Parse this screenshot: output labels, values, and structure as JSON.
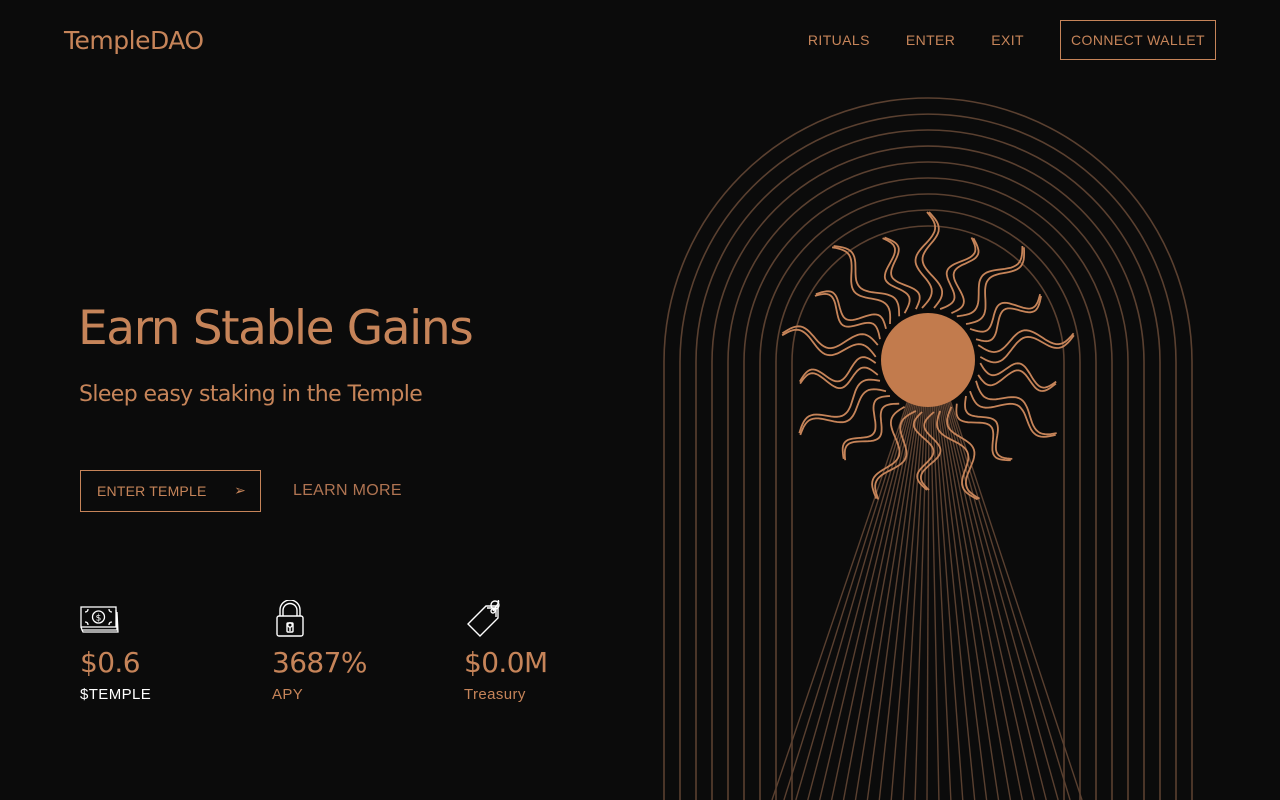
{
  "header": {
    "logo": "TempleDAO",
    "nav": [
      "RITUALS",
      "ENTER",
      "EXIT"
    ],
    "connect_label": "CONNECT WALLET"
  },
  "hero": {
    "title": "Earn Stable Gains",
    "subtitle": "Sleep easy staking in the Temple",
    "enter_label": "ENTER TEMPLE",
    "enter_arrow": "➢",
    "learn_more": "LEARN MORE"
  },
  "stats": [
    {
      "icon": "money-icon",
      "value": "$0.6",
      "label": "$TEMPLE"
    },
    {
      "icon": "lock-icon",
      "value": "3687%",
      "label": "APY"
    },
    {
      "icon": "price-tag-icon",
      "value": "$0.0M",
      "label": "Treasury"
    }
  ],
  "colors": {
    "background": "#0b0b0b",
    "accent": "#c68459",
    "art_lines": "#5a4030",
    "white": "#ffffff"
  },
  "art": {
    "icon": "sun-arch-illustration"
  }
}
